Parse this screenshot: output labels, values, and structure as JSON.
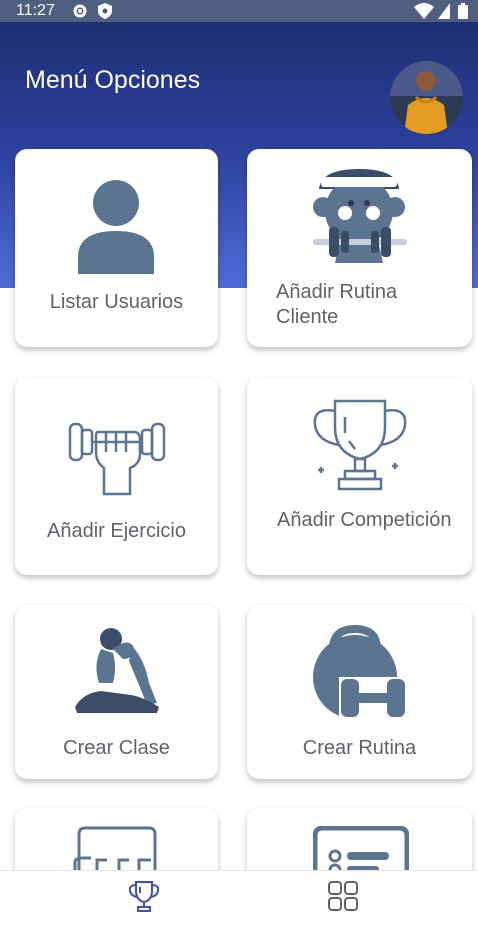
{
  "status_bar": {
    "time": "11:27"
  },
  "header": {
    "title": "Menú Opciones"
  },
  "cards": [
    {
      "label": "Listar Usuarios",
      "icon": "user-icon"
    },
    {
      "label": "Añadir Rutina Cliente",
      "icon": "weightlifter-icon"
    },
    {
      "label": "Añadir Ejercicio",
      "icon": "dumbbell-hand-icon"
    },
    {
      "label": "Añadir Competición",
      "icon": "trophy-icon"
    },
    {
      "label": "Crear Clase",
      "icon": "yoga-pose-icon"
    },
    {
      "label": "Crear Rutina",
      "icon": "kettlebell-dumbbell-icon"
    },
    {
      "label": "",
      "icon": "class-board-icon"
    },
    {
      "label": "",
      "icon": "checklist-icon"
    }
  ],
  "bottom_nav": [
    {
      "icon": "trophy-icon",
      "active": true
    },
    {
      "icon": "grid-icon",
      "active": false
    }
  ],
  "colors": {
    "header_top": "#1f2f72",
    "header_bottom": "#4f6cd6",
    "icon": "#5b7590",
    "label": "#5f6368",
    "nav_active": "#3f51b5"
  }
}
